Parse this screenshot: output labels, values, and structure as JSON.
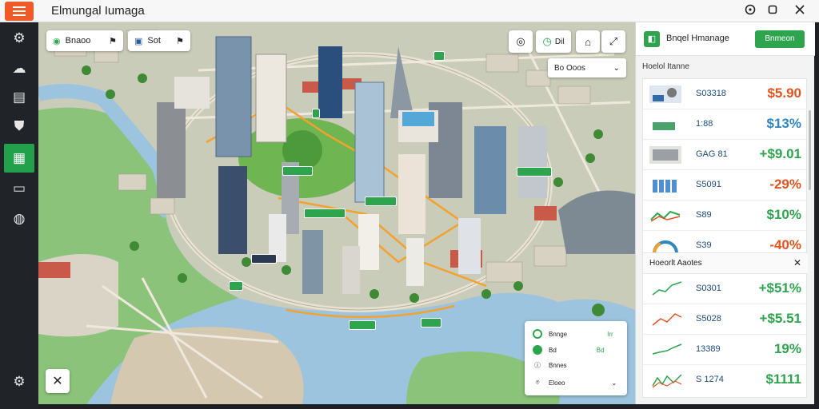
{
  "app": {
    "title": "Elmungal Iumaga",
    "window_icons": [
      "help-icon",
      "maximize-icon",
      "close-icon"
    ]
  },
  "sidebar": {
    "items": [
      {
        "icon": "gear-icon",
        "active": false
      },
      {
        "icon": "upload-cloud-icon",
        "active": false
      },
      {
        "icon": "document-icon",
        "active": false
      },
      {
        "icon": "shield-icon",
        "active": false
      },
      {
        "icon": "table-icon",
        "active": true
      },
      {
        "icon": "card-icon",
        "active": false
      },
      {
        "icon": "globe-icon",
        "active": false
      },
      {
        "icon": "settings-icon",
        "active": false
      }
    ]
  },
  "map": {
    "chip1": {
      "label": "Bnaoo",
      "icon": "compass-icon"
    },
    "chip2": {
      "label": "Sot",
      "icon": "bag-icon"
    },
    "buttons": [
      {
        "icon": "target-icon",
        "label": ""
      },
      {
        "icon": "clock-icon",
        "label": "Dil"
      },
      {
        "icon": "home-icon",
        "label": ""
      },
      {
        "icon": "resize-icon",
        "label": ""
      }
    ],
    "select": {
      "value": "Bo Ooos"
    },
    "layers": {
      "rows": [
        {
          "label": "Bnnge",
          "value": "Irr"
        },
        {
          "label": "Bd",
          "value": "Bd"
        },
        {
          "label": "Bnnes",
          "value": ""
        },
        {
          "label": "Eloeo",
          "value": ""
        }
      ]
    }
  },
  "panel": {
    "header": {
      "title": "Bnqel Hmanage",
      "button": "Bnmeon"
    },
    "section1": {
      "title": "Hoelol Itanne",
      "rows": [
        {
          "name": "S03318",
          "value": "$5.90",
          "color": "#e0541f"
        },
        {
          "name": "1:88",
          "value": "$13%",
          "color": "#2e86c1"
        },
        {
          "name": "GAG 81",
          "value": "+$9.01",
          "color": "#2ea44f"
        },
        {
          "name": "S5091",
          "value": "-29%",
          "color": "#e0541f"
        },
        {
          "name": "S89",
          "value": "$10%",
          "color": "#2ea44f"
        },
        {
          "name": "S39",
          "value": "-40%",
          "color": "#e0541f"
        }
      ]
    },
    "section2": {
      "title": "Hoeorlt Aaotes",
      "rows": [
        {
          "name": "S0301",
          "value": "+$51%",
          "color": "#2ea44f"
        },
        {
          "name": "S5028",
          "value": "+$5.51",
          "color": "#2ea44f"
        },
        {
          "name": "13389",
          "value": "19%",
          "color": "#2ea44f"
        },
        {
          "name": "S 1274",
          "value": "$1111",
          "color": "#2ea44f"
        }
      ]
    }
  },
  "colors": {
    "accent": "#2ea44f",
    "menu": "#f05a28",
    "sidebar": "#202327"
  }
}
